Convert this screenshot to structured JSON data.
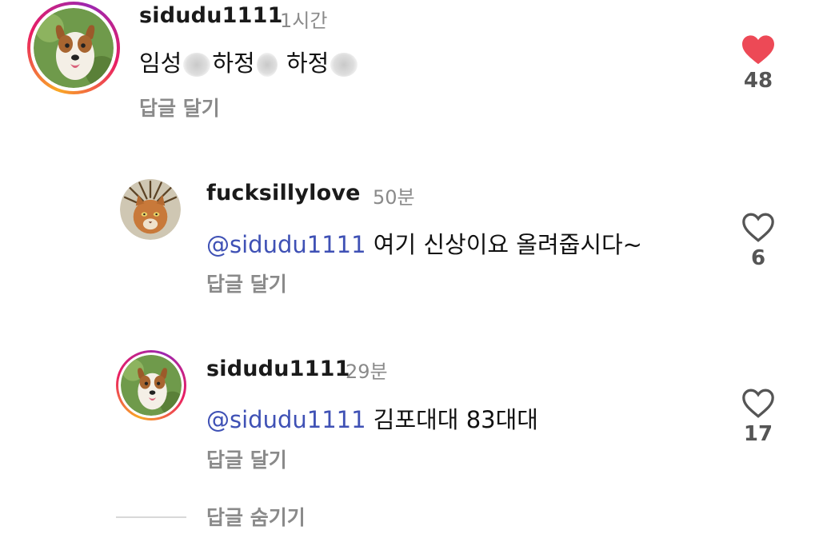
{
  "colors": {
    "mention": "#3f51b5",
    "liked_heart": "#ed4956",
    "muted_text": "#8a8a8a"
  },
  "comments": [
    {
      "username": "sidudu1111",
      "time": "1시간",
      "segments": [
        "임성",
        "하정",
        "하정"
      ],
      "reply_label": "답글 달기",
      "likes": "48",
      "liked": true,
      "avatar_icon": "dog-avatar-icon",
      "has_story_ring": true
    },
    {
      "username": "fucksillylove",
      "time": "50분",
      "mention": "@sidudu1111",
      "text": "여기 신상이요 올려줍시다~",
      "reply_label": "답글 달기",
      "likes": "6",
      "liked": false,
      "avatar_icon": "cat-avatar-icon",
      "has_story_ring": false
    },
    {
      "username": "sidudu1111",
      "time": "29분",
      "mention": "@sidudu1111",
      "text": "김포대대 83대대",
      "reply_label": "답글 달기",
      "likes": "17",
      "liked": false,
      "avatar_icon": "dog-avatar-icon",
      "has_story_ring": true
    }
  ],
  "hide_replies_label": "답글 숨기기"
}
